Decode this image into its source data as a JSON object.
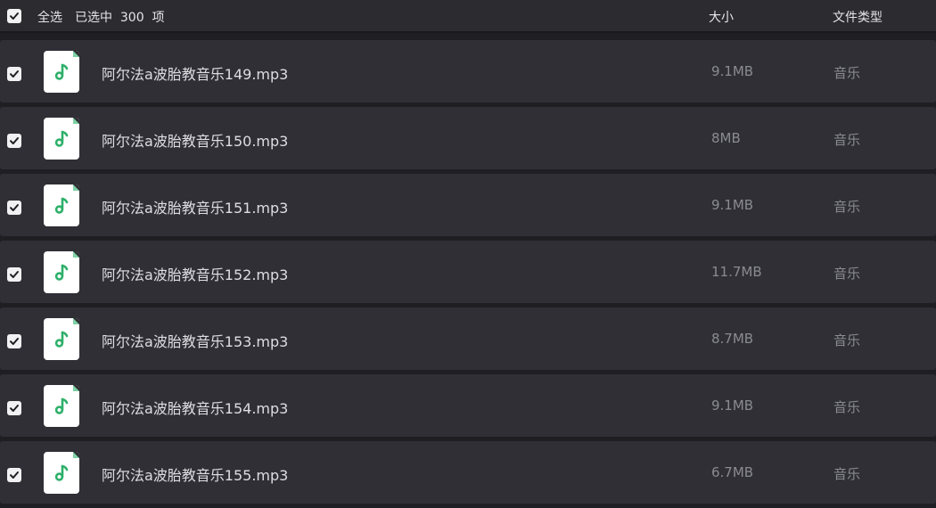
{
  "header": {
    "select_all_label": "全选",
    "selected_count_text": "已选中  300  项",
    "size_column": "大小",
    "type_column": "文件类型"
  },
  "files": [
    {
      "name": "阿尔法a波胎教音乐149.mp3",
      "size": "9.1MB",
      "type": "音乐",
      "checked": true
    },
    {
      "name": "阿尔法a波胎教音乐150.mp3",
      "size": "8MB",
      "type": "音乐",
      "checked": true
    },
    {
      "name": "阿尔法a波胎教音乐151.mp3",
      "size": "9.1MB",
      "type": "音乐",
      "checked": true
    },
    {
      "name": "阿尔法a波胎教音乐152.mp3",
      "size": "11.7MB",
      "type": "音乐",
      "checked": true
    },
    {
      "name": "阿尔法a波胎教音乐153.mp3",
      "size": "8.7MB",
      "type": "音乐",
      "checked": true
    },
    {
      "name": "阿尔法a波胎教音乐154.mp3",
      "size": "9.1MB",
      "type": "音乐",
      "checked": true
    },
    {
      "name": "阿尔法a波胎教音乐155.mp3",
      "size": "6.7MB",
      "type": "音乐",
      "checked": true
    }
  ],
  "icons": {
    "checkbox": "checkbox-checked-icon",
    "file": "music-file-icon"
  },
  "colors": {
    "background": "#1f1f23",
    "row_background": "#2f2f35",
    "header_background": "#2b2b30",
    "music_icon_green": "#2fb06a",
    "checkbox_fill": "#f1f1f3"
  }
}
